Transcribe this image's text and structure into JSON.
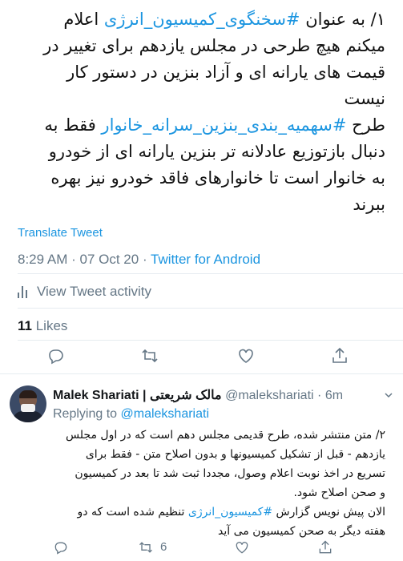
{
  "tweet": {
    "lines": [
      [
        {
          "t": "۱/ به عنوان ",
          "h": false
        },
        {
          "t": "#سخنگوی_کمیسیون_انرژی",
          "h": true
        },
        {
          "t": " اعلام",
          "h": false
        }
      ],
      [
        {
          "t": "میکنم هیچ طرحی در مجلس یازدهم برای تغییر در",
          "h": false
        }
      ],
      [
        {
          "t": "قیمت های یارانه ای و آزاد بنزین در دستور کار",
          "h": false
        }
      ],
      [
        {
          "t": "نیست",
          "h": false
        }
      ],
      [
        {
          "t": "طرح ",
          "h": false
        },
        {
          "t": "#سهمیه_بندی_بنزین_سرانه_خانوار",
          "h": true
        },
        {
          "t": " فقط به",
          "h": false
        }
      ],
      [
        {
          "t": "دنبال بازتوزیع عادلانه تر بنزین یارانه ای از خودرو",
          "h": false
        }
      ],
      [
        {
          "t": "به خانوار است تا خانوارهای فاقد خودرو نیز بهره",
          "h": false
        }
      ],
      [
        {
          "t": "ببرند",
          "h": false
        }
      ]
    ],
    "translate_label": "Translate Tweet",
    "time": "8:29 AM",
    "date": "07 Oct 20",
    "source": "Twitter for Android",
    "activity_label": "View Tweet activity",
    "likes_count": "11",
    "likes_label": "Likes"
  },
  "reply": {
    "display_name": "Malek Shariati | مالک شریعتی",
    "handle": "@malekshariati",
    "time": "6m",
    "replying_prefix": "Replying to ",
    "replying_to": "@malekshariati",
    "lines": [
      [
        {
          "t": "۲/ متن منتشر شده، طرح قدیمی مجلس دهم است که در اول مجلس",
          "h": false
        }
      ],
      [
        {
          "t": "یازدهم - قبل از تشکیل کمیسیونها و بدون اصلاح متن - فقط برای",
          "h": false
        }
      ],
      [
        {
          "t": "تسریع در اخذ نوبت اعلام وصول، مجددا ثبت شد تا بعد در کمیسیون",
          "h": false
        }
      ],
      [
        {
          "t": "و صحن اصلاح شود.",
          "h": false
        }
      ],
      [
        {
          "t": "الان پیش نویس گزارش ",
          "h": false
        },
        {
          "t": "#کمیسیون_انرژی",
          "h": true
        },
        {
          "t": " تنظیم شده است که دو",
          "h": false
        }
      ],
      [
        {
          "t": "هفته دیگر به صحن کمیسیون می آید",
          "h": false
        }
      ]
    ],
    "retweet_count": "6"
  },
  "colors": {
    "link": "#1b95e0",
    "muted": "#657786",
    "text": "#14171a",
    "divider": "#e6ecf0"
  },
  "icons": [
    "reply-icon",
    "retweet-icon",
    "like-icon",
    "share-icon",
    "activity-icon",
    "chevron-down-icon"
  ]
}
